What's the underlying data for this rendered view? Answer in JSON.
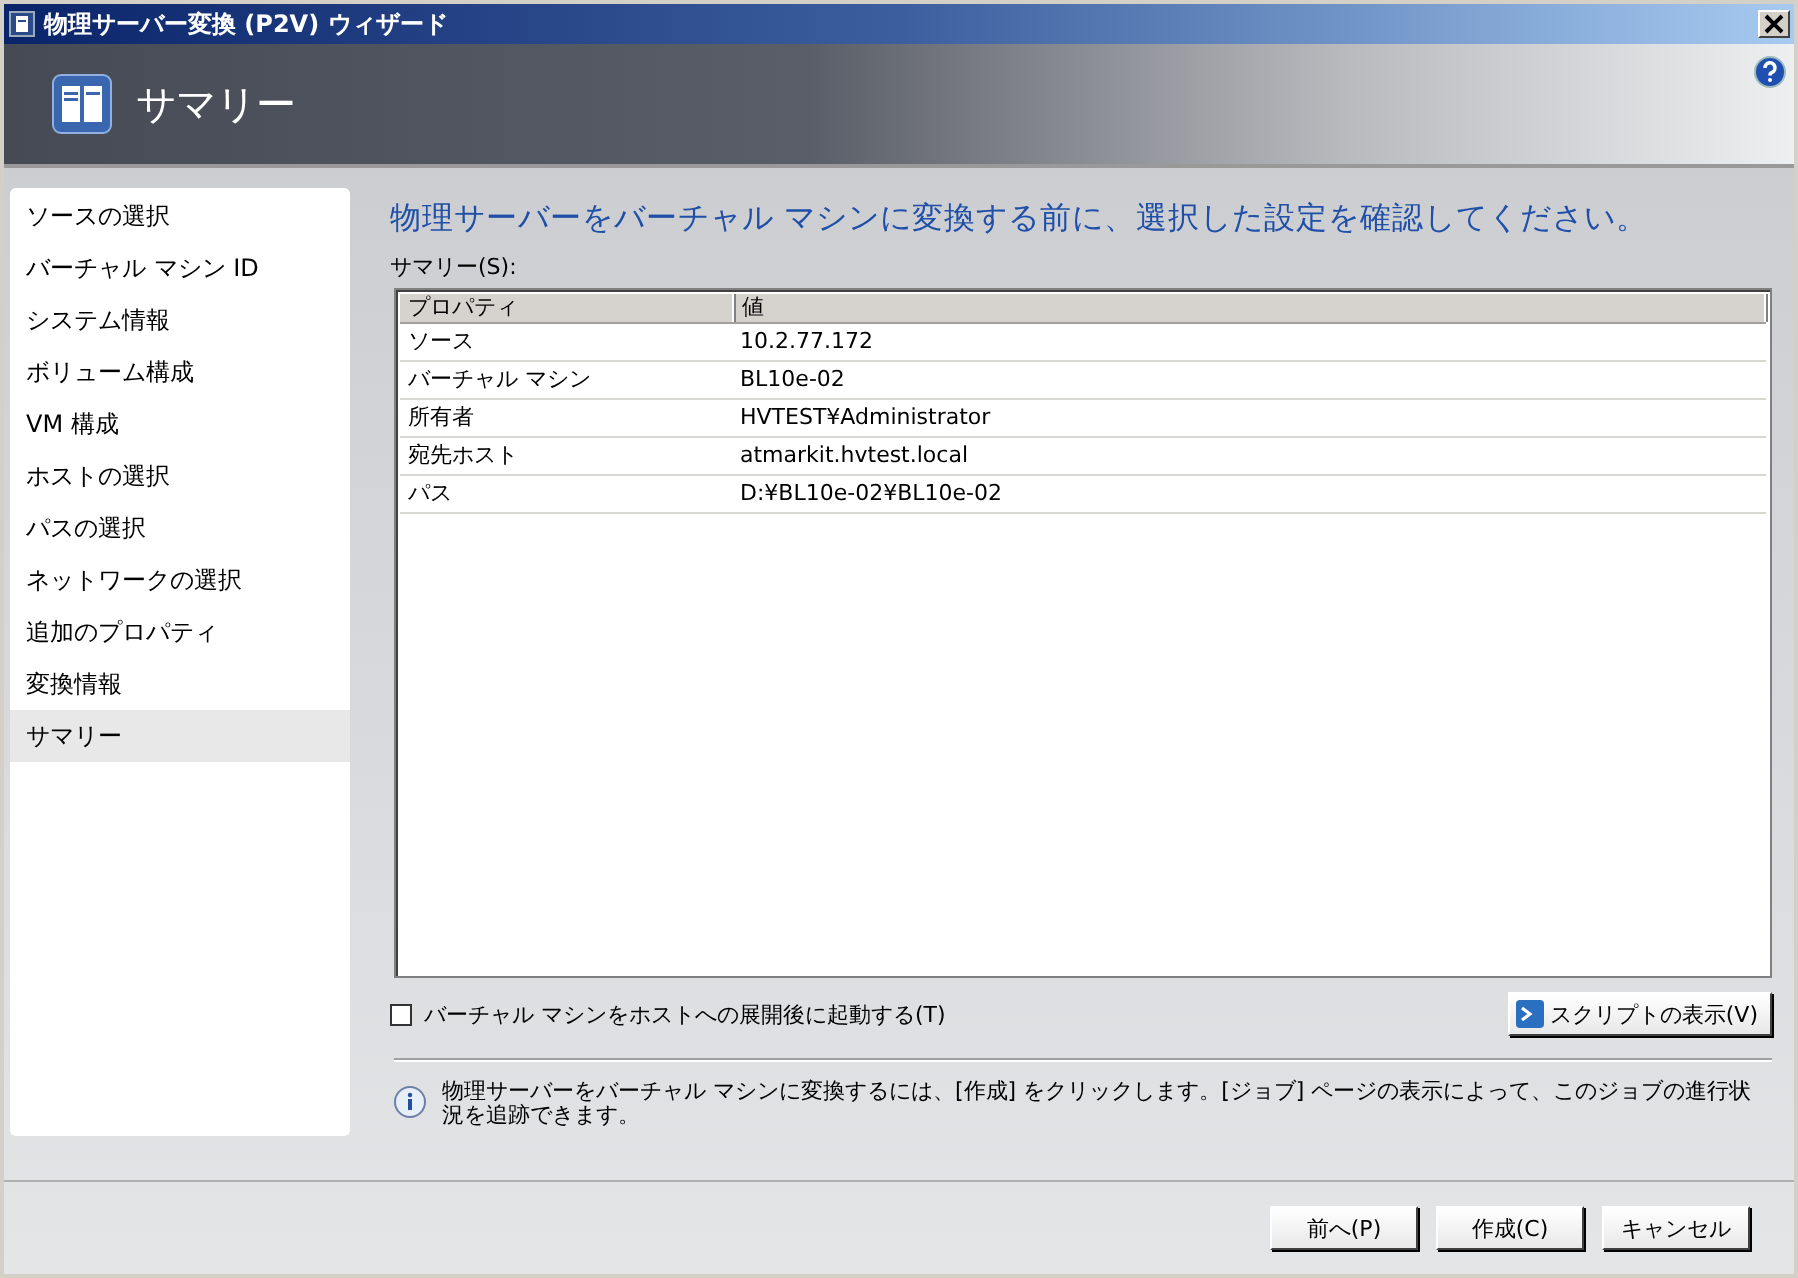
{
  "window": {
    "title": "物理サーバー変換 (P2V) ウィザード"
  },
  "header": {
    "title": "サマリー"
  },
  "sidebar": {
    "items": [
      {
        "label": "ソースの選択",
        "selected": false
      },
      {
        "label": "バーチャル マシン ID",
        "selected": false
      },
      {
        "label": "システム情報",
        "selected": false
      },
      {
        "label": "ボリューム構成",
        "selected": false
      },
      {
        "label": "VM 構成",
        "selected": false
      },
      {
        "label": "ホストの選択",
        "selected": false
      },
      {
        "label": "パスの選択",
        "selected": false
      },
      {
        "label": "ネットワークの選択",
        "selected": false
      },
      {
        "label": "追加のプロパティ",
        "selected": false
      },
      {
        "label": "変換情報",
        "selected": false
      },
      {
        "label": "サマリー",
        "selected": true
      }
    ]
  },
  "main": {
    "heading": "物理サーバーをバーチャル マシンに変換する前に、選択した設定を確認してください。",
    "summary_label": "サマリー(S):",
    "table": {
      "columns": [
        "プロパティ",
        "値"
      ],
      "rows": [
        [
          "ソース",
          "10.2.77.172"
        ],
        [
          "バーチャル マシン",
          "BL10e-02"
        ],
        [
          "所有者",
          "HVTEST¥Administrator"
        ],
        [
          "宛先ホスト",
          "atmarkit.hvtest.local"
        ],
        [
          "パス",
          "D:¥BL10e-02¥BL10e-02"
        ]
      ]
    },
    "start_checkbox": {
      "label": "バーチャル マシンをホストへの展開後に起動する(T)",
      "checked": false
    },
    "script_button": "スクリプトの表示(V)",
    "info": "物理サーバーをバーチャル マシンに変換するには、[作成] をクリックします。[ジョブ] ページの表示によって、このジョブの進行状況を追跡できます。"
  },
  "buttons": [
    "前へ(P)",
    "作成(C)",
    "キャンセル"
  ]
}
